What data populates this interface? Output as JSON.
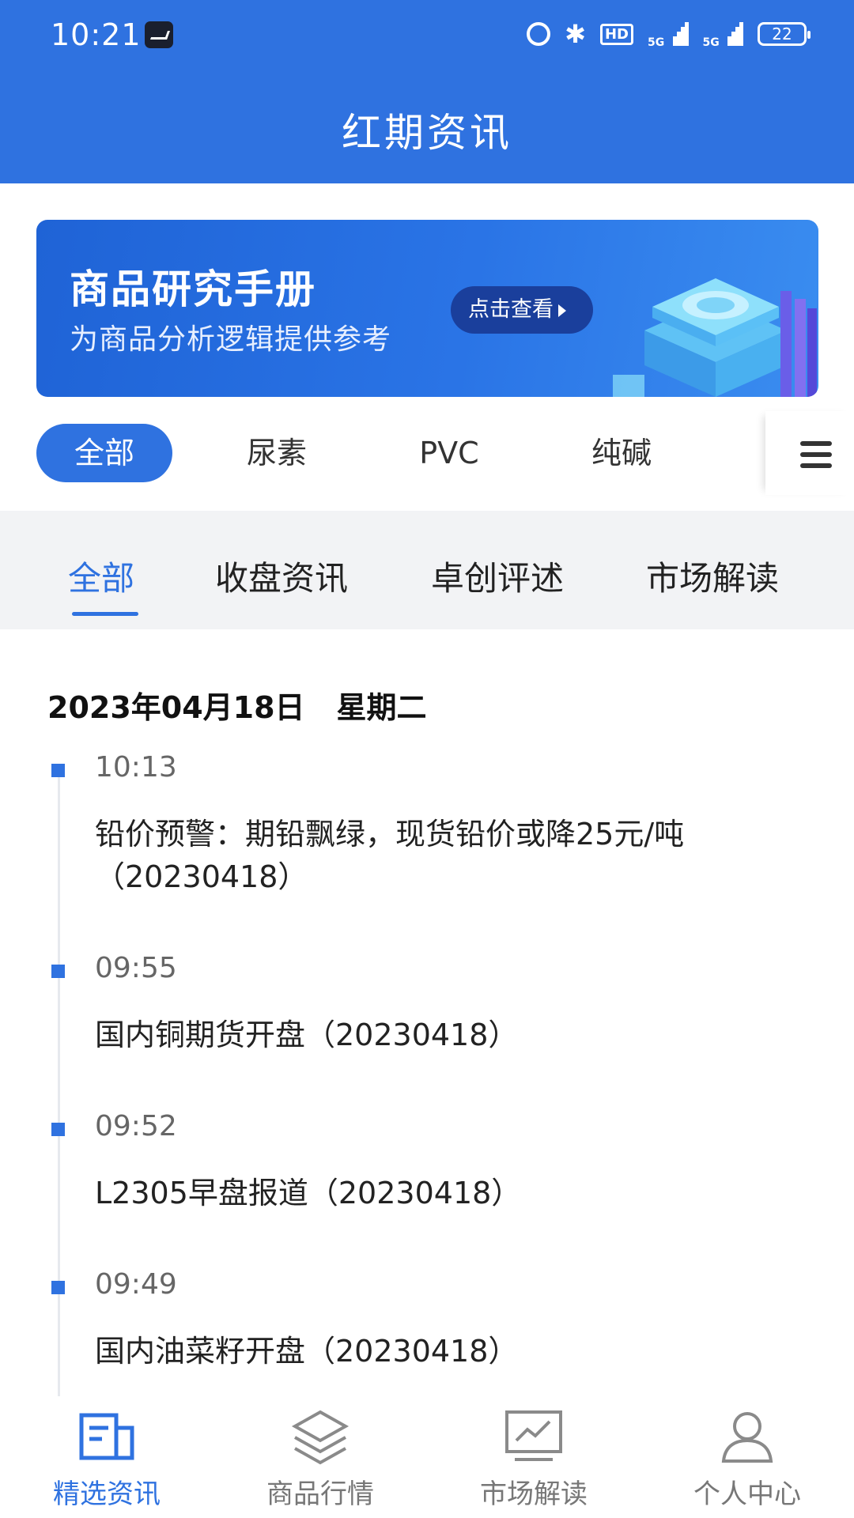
{
  "status_bar": {
    "time": "10:21",
    "hd_label": "HD",
    "network_1": "5G",
    "network_2": "5G",
    "battery": "22"
  },
  "header": {
    "title": "红期资讯"
  },
  "banner": {
    "title": "商品研究手册",
    "subtitle": "为商品分析逻辑提供参考",
    "button_label": "点击查看"
  },
  "chips": [
    {
      "label": "全部",
      "active": true
    },
    {
      "label": "尿素",
      "active": false
    },
    {
      "label": "PVC",
      "active": false
    },
    {
      "label": "纯碱",
      "active": false
    }
  ],
  "subtabs": [
    {
      "label": "全部",
      "active": true
    },
    {
      "label": "收盘资讯",
      "active": false
    },
    {
      "label": "卓创评述",
      "active": false
    },
    {
      "label": "市场解读",
      "active": false
    }
  ],
  "feed": {
    "date": "2023年04月18日",
    "weekday": "星期二",
    "items": [
      {
        "time": "10:13",
        "text": "铅价预警：期铅飘绿，现货铅价或降25元/吨（20230418）"
      },
      {
        "time": "09:55",
        "text": "国内铜期货开盘（20230418）"
      },
      {
        "time": "09:52",
        "text": "L2305早盘报道（20230418）"
      },
      {
        "time": "09:49",
        "text": "国内油菜籽开盘（20230418）"
      }
    ]
  },
  "bottom_nav": [
    {
      "label": "精选资讯",
      "icon": "news-icon",
      "active": true
    },
    {
      "label": "商品行情",
      "icon": "layers-icon",
      "active": false
    },
    {
      "label": "市场解读",
      "icon": "monitor-chart-icon",
      "active": false
    },
    {
      "label": "个人中心",
      "icon": "user-icon",
      "active": false
    }
  ],
  "colors": {
    "accent": "#2f72e0",
    "tab_bg": "#f2f3f5"
  }
}
